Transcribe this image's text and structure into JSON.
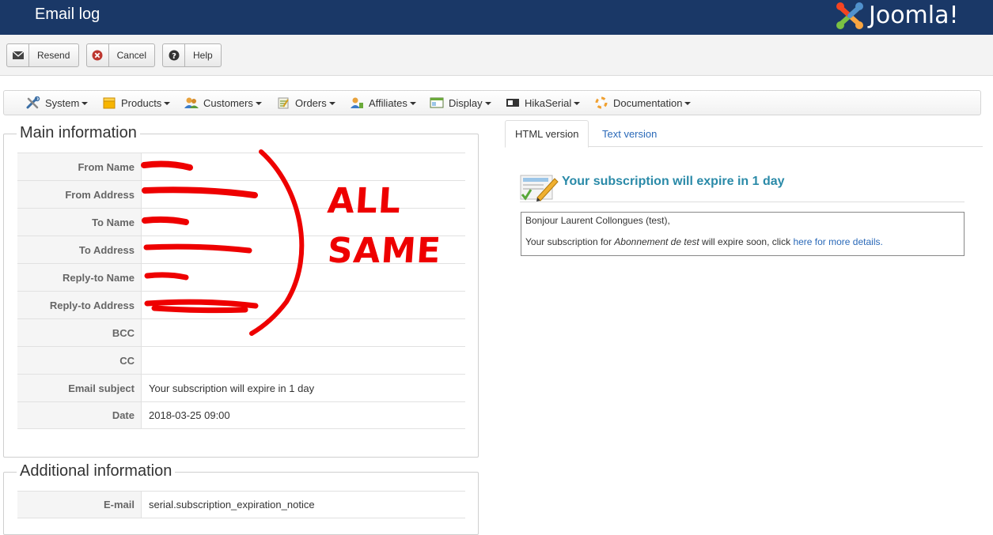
{
  "header": {
    "title": "Email log",
    "brand": "Joomla!"
  },
  "toolbar": {
    "resend_label": "Resend",
    "cancel_label": "Cancel",
    "help_label": "Help"
  },
  "menu": {
    "items": [
      {
        "label": "System",
        "icon": "tools-icon"
      },
      {
        "label": "Products",
        "icon": "box-icon"
      },
      {
        "label": "Customers",
        "icon": "users-icon"
      },
      {
        "label": "Orders",
        "icon": "clipboard-icon"
      },
      {
        "label": "Affiliates",
        "icon": "affiliates-icon"
      },
      {
        "label": "Display",
        "icon": "window-icon"
      },
      {
        "label": "HikaSerial",
        "icon": "serial-icon"
      },
      {
        "label": "Documentation",
        "icon": "lifebuoy-icon"
      }
    ]
  },
  "main_info": {
    "legend": "Main information",
    "rows": [
      {
        "label": "From Name",
        "value": ""
      },
      {
        "label": "From Address",
        "value": ""
      },
      {
        "label": "To Name",
        "value": ""
      },
      {
        "label": "To Address",
        "value": ""
      },
      {
        "label": "Reply-to Name",
        "value": ""
      },
      {
        "label": "Reply-to Address",
        "value": ""
      },
      {
        "label": "BCC",
        "value": ""
      },
      {
        "label": "CC",
        "value": ""
      },
      {
        "label": "Email subject",
        "value": "Your subscription will expire in 1 day"
      },
      {
        "label": "Date",
        "value": "2018-03-25 09:00"
      }
    ]
  },
  "additional_info": {
    "legend": "Additional information",
    "rows": [
      {
        "label": "E-mail",
        "value": "serial.subscription_expiration_notice"
      }
    ]
  },
  "preview": {
    "tabs": [
      {
        "label": "HTML version",
        "active": true
      },
      {
        "label": "Text version",
        "active": false
      }
    ],
    "subject": "Your subscription will expire in 1 day",
    "greeting": "Bonjour Laurent Collongues (test),",
    "body_prefix": "Your subscription for ",
    "body_product": "Abonnement de test",
    "body_mid": " will expire soon, click ",
    "body_link": "here for more details."
  },
  "annotation": {
    "line1": "ALL",
    "line2": "SAME",
    "color": "#ee0000"
  },
  "colors": {
    "header_bg": "#1a3867",
    "link": "#2a69b8",
    "subject": "#2a8aa8"
  }
}
